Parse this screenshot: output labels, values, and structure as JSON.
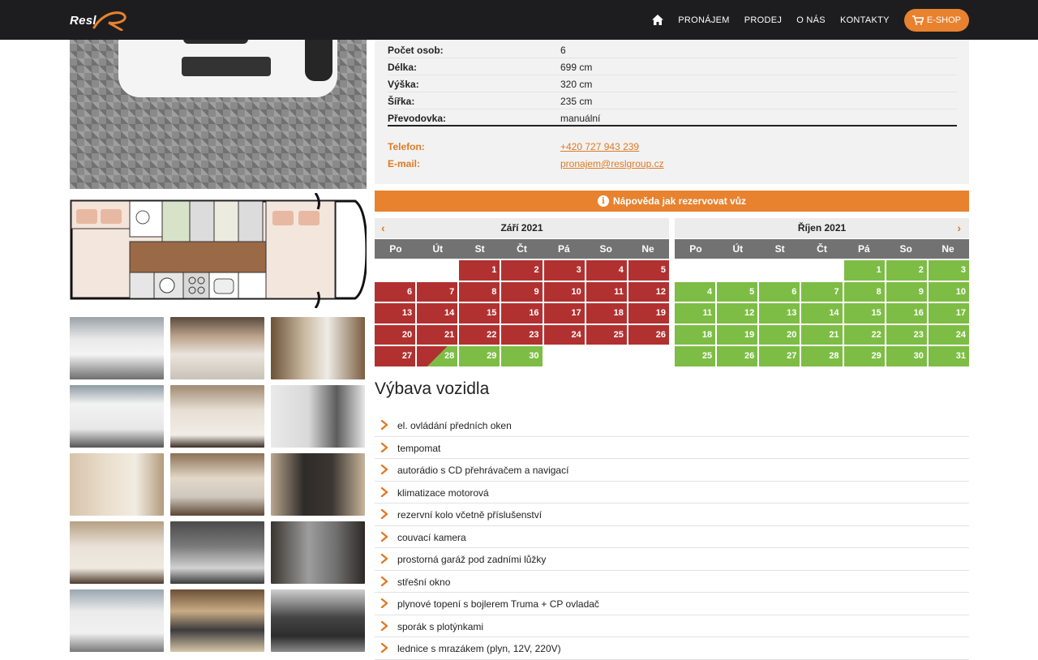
{
  "header": {
    "logo_text": "Resl",
    "nav": [
      "PRONÁJEM",
      "PRODEJ",
      "O NÁS",
      "KONTAKTY"
    ],
    "eshop_label": "E-SHOP",
    "colors": {
      "accent": "#e8822e",
      "bar": "#1d1d1f"
    }
  },
  "specs": [
    {
      "label": "Počet osob:",
      "value": "6"
    },
    {
      "label": "Délka:",
      "value": "699 cm"
    },
    {
      "label": "Výška:",
      "value": "320 cm"
    },
    {
      "label": "Šířka:",
      "value": "235 cm"
    },
    {
      "label": "Převodovka:",
      "value": "manuální"
    }
  ],
  "contacts": [
    {
      "label": "Telefon:",
      "value": "+420 727 943 239"
    },
    {
      "label": "E-mail:",
      "value": "pronajem@reslgroup.cz"
    }
  ],
  "help_bar": "Nápověda jak rezervovat vůz",
  "calendar": {
    "weekdays": [
      "Po",
      "Út",
      "St",
      "Čt",
      "Pá",
      "So",
      "Ne"
    ],
    "months": [
      {
        "title": "Září 2021",
        "days": [
          {
            "d": "",
            "s": "empty"
          },
          {
            "d": "",
            "s": "empty"
          },
          {
            "d": "1",
            "s": "red"
          },
          {
            "d": "2",
            "s": "red"
          },
          {
            "d": "3",
            "s": "red"
          },
          {
            "d": "4",
            "s": "red"
          },
          {
            "d": "5",
            "s": "red"
          },
          {
            "d": "6",
            "s": "red"
          },
          {
            "d": "7",
            "s": "red"
          },
          {
            "d": "8",
            "s": "red"
          },
          {
            "d": "9",
            "s": "red"
          },
          {
            "d": "10",
            "s": "red"
          },
          {
            "d": "11",
            "s": "red"
          },
          {
            "d": "12",
            "s": "red"
          },
          {
            "d": "13",
            "s": "red"
          },
          {
            "d": "14",
            "s": "red"
          },
          {
            "d": "15",
            "s": "red"
          },
          {
            "d": "16",
            "s": "red"
          },
          {
            "d": "17",
            "s": "red"
          },
          {
            "d": "18",
            "s": "red"
          },
          {
            "d": "19",
            "s": "red"
          },
          {
            "d": "20",
            "s": "red"
          },
          {
            "d": "21",
            "s": "red"
          },
          {
            "d": "22",
            "s": "red"
          },
          {
            "d": "23",
            "s": "red"
          },
          {
            "d": "24",
            "s": "red"
          },
          {
            "d": "25",
            "s": "red"
          },
          {
            "d": "26",
            "s": "red"
          },
          {
            "d": "27",
            "s": "red"
          },
          {
            "d": "28",
            "s": "split"
          },
          {
            "d": "29",
            "s": "green"
          },
          {
            "d": "30",
            "s": "green"
          }
        ]
      },
      {
        "title": "Říjen 2021",
        "days": [
          {
            "d": "",
            "s": "empty"
          },
          {
            "d": "",
            "s": "empty"
          },
          {
            "d": "",
            "s": "empty"
          },
          {
            "d": "",
            "s": "empty"
          },
          {
            "d": "1",
            "s": "green"
          },
          {
            "d": "2",
            "s": "green"
          },
          {
            "d": "3",
            "s": "green"
          },
          {
            "d": "4",
            "s": "green"
          },
          {
            "d": "5",
            "s": "green"
          },
          {
            "d": "6",
            "s": "green"
          },
          {
            "d": "7",
            "s": "green"
          },
          {
            "d": "8",
            "s": "green"
          },
          {
            "d": "9",
            "s": "green"
          },
          {
            "d": "10",
            "s": "green"
          },
          {
            "d": "11",
            "s": "green"
          },
          {
            "d": "12",
            "s": "green"
          },
          {
            "d": "13",
            "s": "green"
          },
          {
            "d": "14",
            "s": "green"
          },
          {
            "d": "15",
            "s": "green"
          },
          {
            "d": "16",
            "s": "green"
          },
          {
            "d": "17",
            "s": "green"
          },
          {
            "d": "18",
            "s": "green"
          },
          {
            "d": "19",
            "s": "green"
          },
          {
            "d": "20",
            "s": "green"
          },
          {
            "d": "21",
            "s": "green"
          },
          {
            "d": "22",
            "s": "green"
          },
          {
            "d": "23",
            "s": "green"
          },
          {
            "d": "24",
            "s": "green"
          },
          {
            "d": "25",
            "s": "green"
          },
          {
            "d": "26",
            "s": "green"
          },
          {
            "d": "27",
            "s": "green"
          },
          {
            "d": "28",
            "s": "green"
          },
          {
            "d": "29",
            "s": "green"
          },
          {
            "d": "30",
            "s": "green"
          },
          {
            "d": "31",
            "s": "green"
          }
        ]
      }
    ],
    "colors": {
      "booked": "#b13131",
      "free": "#7dbd45"
    }
  },
  "equipment": {
    "title": "Výbava vozidla",
    "items": [
      "el. ovládání předních oken",
      "tempomat",
      "autorádio s CD přehrávačem a navigací",
      "klimatizace motorová",
      "rezervní kolo včetně příslušenství",
      "couvací kamera",
      "prostorná garáž pod zadními lůžky",
      "střešní okno",
      "plynové topení s bojlerem Truma + CP ovladač",
      "sporák s plotýnkami",
      "lednice s mrazákem (plyn, 12V, 220V)"
    ]
  },
  "gallery": {
    "thumbs": [
      {
        "name": "camper-exterior-front",
        "bg": "linear-gradient(180deg,#9aa2a8 0%,#e9e9e9 35%,#f4f4f4 60%,#6e6e6e 100%)"
      },
      {
        "name": "interior-bed-area",
        "bg": "linear-gradient(180deg,#5a4a3c 0%,#b9a089 30%,#eae4dc 60%,#c9c2b8 100%)"
      },
      {
        "name": "bathroom-toilet",
        "bg": "linear-gradient(90deg,#6b5238 0%,#c8b89f 35%,#efece6 60%,#7a5d40 100%)"
      },
      {
        "name": "camper-exterior-side",
        "bg": "linear-gradient(180deg,#8d9aa3 0%,#f2f2f2 30%,#e8e8e8 70%,#555 100%)"
      },
      {
        "name": "interior-bed-mattress",
        "bg": "linear-gradient(180deg,#a08a72 0%,#e6dfd3 40%,#f1ede6 80%,#3a2e24 100%)"
      },
      {
        "name": "camper-rear-bike-rack",
        "bg": "linear-gradient(90deg,#e9e9e9 0%,#d9d9d9 40%,#5c5c5c 70%,#e7e7e7 100%)"
      },
      {
        "name": "shower-cabin",
        "bg": "linear-gradient(90deg,#d7c3ab 0%,#eadfce 40%,#f2ece2 70%,#b39a7d 100%)"
      },
      {
        "name": "kitchen-sink",
        "bg": "linear-gradient(180deg,#8b7055 0%,#e3d8c9 40%,#cfc7bd 70%,#5b4634 100%)"
      },
      {
        "name": "wardrobe-door",
        "bg": "linear-gradient(90deg,#b9a68f 0%,#2f2b28 35%,#3c3632 65%,#c8b59b 100%)"
      },
      {
        "name": "table-top",
        "bg": "linear-gradient(180deg,#b79f85 0%,#e9e2d8 40%,#efe9e0 75%,#4b3a2c 100%)"
      },
      {
        "name": "cabin-seats",
        "bg": "linear-gradient(180deg,#4a4a4a 0%,#7a7a7a 40%,#d2d2d2 75%,#3a3a3a 100%)"
      },
      {
        "name": "floor-detail",
        "bg": "linear-gradient(90deg,#3a3530 0%,#9d9d9d 40%,#6e6e6e 70%,#2c2825 100%)"
      },
      {
        "name": "camper-exterior-rear",
        "bg": "linear-gradient(180deg,#9aa7b0 0%,#ebebeb 35%,#f1f1f1 70%,#777 100%)"
      },
      {
        "name": "overhead-cabinet",
        "bg": "linear-gradient(180deg,#6b5036 0%,#c9ac86 35%,#3c3c3c 65%,#d8c5a8 100%)"
      },
      {
        "name": "dashboard",
        "bg": "linear-gradient(180deg,#cfcfcf 0%,#444 45%,#2d2d2d 75%,#8a8a8a 100%)"
      }
    ]
  }
}
